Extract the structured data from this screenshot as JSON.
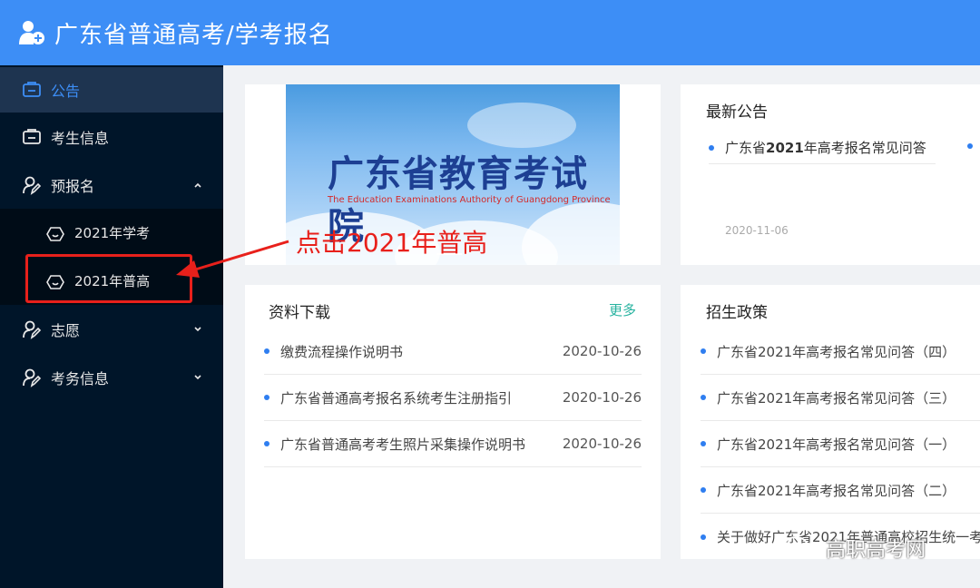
{
  "header": {
    "title": "广东省普通高考/学考报名"
  },
  "sidebar": {
    "items": [
      {
        "label": "公告",
        "icon": "announcement-icon"
      },
      {
        "label": "考生信息",
        "icon": "id-card-icon"
      },
      {
        "label": "预报名",
        "icon": "user-edit-icon"
      },
      {
        "label": "志愿",
        "icon": "user-edit-icon"
      },
      {
        "label": "考务信息",
        "icon": "user-edit-icon"
      }
    ],
    "submenu": [
      {
        "label": "2021年学考"
      },
      {
        "label": "2021年普高"
      }
    ]
  },
  "annotation": {
    "text_a": "点击2021年",
    "text_b": "普",
    "text_c": "高",
    "color": "#e8201b"
  },
  "banner": {
    "title": "广东省教育考试院",
    "subtitle": "The Education Examinations Authority of Guangdong Province"
  },
  "notices": {
    "title": "最新公告",
    "items": [
      {
        "prefix": "广东省",
        "bold": "2021",
        "suffix": "年高考报名常见问答"
      }
    ],
    "date": "2020-11-06"
  },
  "downloads": {
    "title": "资料下载",
    "more": "更多",
    "items": [
      {
        "label": "缴费流程操作说明书",
        "date": "2020-10-26"
      },
      {
        "label": "广东省普通高考报名系统考生注册指引",
        "date": "2020-10-26"
      },
      {
        "label": "广东省普通高考考生照片采集操作说明书",
        "date": "2020-10-26"
      }
    ]
  },
  "policy": {
    "title": "招生政策",
    "items": [
      {
        "label": "广东省2021年高考报名常见问答（四）"
      },
      {
        "label": "广东省2021年高考报名常见问答（三）"
      },
      {
        "label": "广东省2021年高考报名常见问答（一）"
      },
      {
        "label": "广东省2021年高考报名常见问答（二）"
      },
      {
        "label": "关于做好广东省2021年普通高校招生统一考"
      }
    ]
  },
  "watermark": {
    "text": "高职高考网"
  },
  "colors": {
    "header": "#3d8ef6",
    "sidebar": "#001529",
    "accent": "#2f7ef0",
    "more": "#28b3a0"
  }
}
